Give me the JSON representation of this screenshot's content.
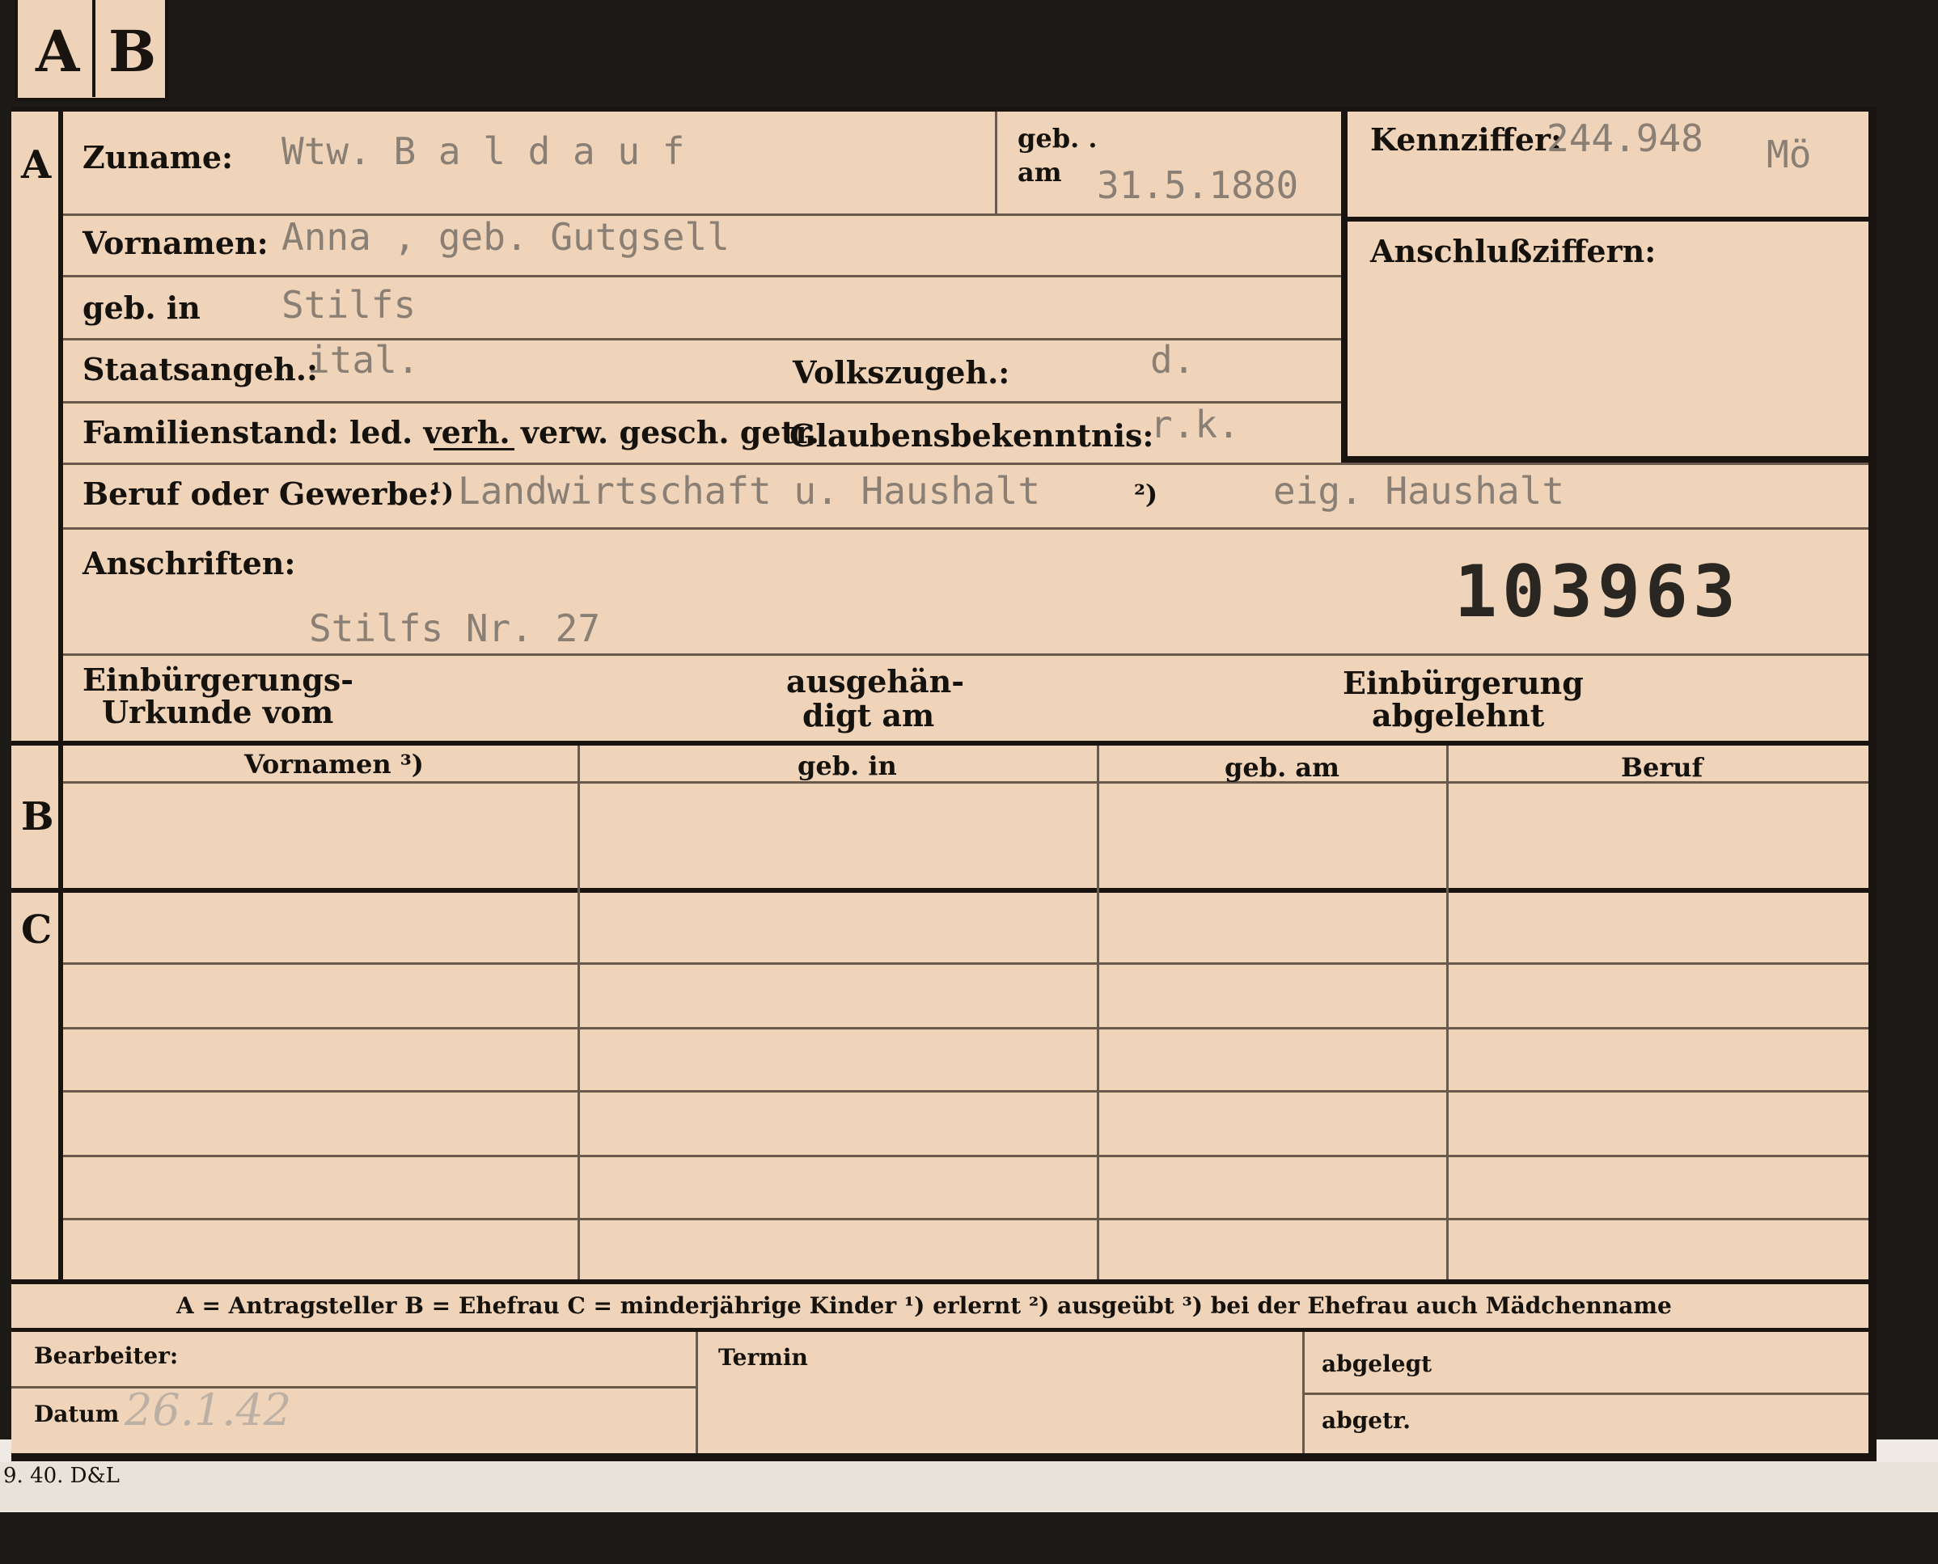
{
  "tab": {
    "letter_a": "A",
    "letter_b": "B"
  },
  "sections": {
    "a": "A",
    "b": "B",
    "c": "C"
  },
  "header": {
    "zuname_label": "Zuname:",
    "zuname_value": "Wtw. B a l d a u f",
    "geb_label": "geb. .",
    "am_label": "am",
    "geb_am_value": "31.5.1880",
    "kennziffer_label": "Kennziffer:",
    "kennziffer_value": "244.948",
    "kennziffer_suffix": "Mö",
    "anschlussziffern_label": "Anschlußziffern:"
  },
  "person": {
    "vornamen_label": "Vornamen:",
    "vornamen_value": "Anna , geb. Gutgsell",
    "geb_in_label": "geb. in",
    "geb_in_value": "Stilfs",
    "staatsangeh_label": "Staatsangeh.:",
    "staatsangeh_value": "ital.",
    "volkszugeh_label": "Volkszugeh.:",
    "volkszugeh_value": "d.",
    "familienstand_label": "Familienstand: led. verh. verw. gesch. getr.",
    "glaubensbekenntnis_label": "Glaubensbekenntnis:",
    "glaubensbekenntnis_value": "r.k.",
    "beruf_label": "Beruf oder Gewerbe:",
    "beruf_mark1": "¹)",
    "beruf_value1": "Landwirtschaft u. Haushalt",
    "beruf_mark2": "²)",
    "beruf_value2": "eig. Haushalt",
    "anschriften_label": "Anschriften:",
    "anschriften_value": "Stilfs Nr. 27",
    "big_number": "103963",
    "einbuergerung_urkunde_label_1": "Einbürgerungs-",
    "einbuergerung_urkunde_label_2": "Urkunde vom",
    "ausgehaendigt_label_1": "ausgehän-",
    "ausgehaendigt_label_2": "digt am",
    "einbuergerung_abgelehnt_label_1": "Einbürgerung",
    "einbuergerung_abgelehnt_label_2": "abgelehnt"
  },
  "table": {
    "headers": [
      "Vornamen ³)",
      "geb. in",
      "geb. am",
      "Beruf"
    ]
  },
  "legend": {
    "text": "A = Antragsteller   B = Ehefrau   C = minderjährige Kinder   ¹) erlernt   ²) ausgeübt   ³) bei der Ehefrau auch Mädchenname"
  },
  "footer": {
    "bearbeiter_label": "Bearbeiter:",
    "datum_label": "Datum",
    "datum_value": "26.1.42",
    "termin_label": "Termin",
    "abgelegt_label": "abgelegt",
    "abgetr_label": "abgetr."
  },
  "imprint": "9. 40. D&L"
}
